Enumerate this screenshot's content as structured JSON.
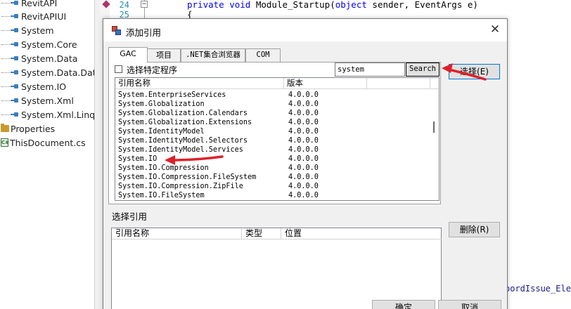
{
  "solution_tree": {
    "items": [
      {
        "label": "RevitAPI",
        "icon": "reference-icon"
      },
      {
        "label": "RevitAPIUI",
        "icon": "reference-icon"
      },
      {
        "label": "System",
        "icon": "reference-icon"
      },
      {
        "label": "System.Core",
        "icon": "reference-icon"
      },
      {
        "label": "System.Data",
        "icon": "reference-icon"
      },
      {
        "label": "System.Data.DataSetExtensions",
        "icon": "reference-icon"
      },
      {
        "label": "System.IO",
        "icon": "reference-icon"
      },
      {
        "label": "System.Xml",
        "icon": "reference-icon"
      },
      {
        "label": "System.Xml.Linq",
        "icon": "reference-icon"
      },
      {
        "label": "Properties",
        "icon": "folder-icon"
      },
      {
        "label": "ThisDocument.cs",
        "icon": "csharp-file-icon"
      }
    ]
  },
  "editor": {
    "line_numbers": [
      "24",
      "25"
    ],
    "code_24_keywords": "private void",
    "code_24_method": " Module_Startup(",
    "code_24_kw2": "object",
    "code_24_rest": " sender, EventArgs e)",
    "code_25": "{",
    "fold_glyph": "−",
    "overflow_text": "oordIssue_Ele"
  },
  "dialog": {
    "title": "添加引用",
    "close_glyph": "✕",
    "tabs": [
      "GAC",
      "项目",
      ".NET集合浏览器",
      "COM"
    ],
    "active_tab": "GAC",
    "checkbox_label": "选择特定程序",
    "checkbox_checked": false,
    "search_value": "system",
    "search_button": "Search",
    "gac_columns": {
      "name": "引用名称",
      "version": "版本"
    },
    "gac_rows": [
      {
        "name": "System.EnterpriseServices",
        "version": "4.0.0.0"
      },
      {
        "name": "System.Globalization",
        "version": "4.0.0.0"
      },
      {
        "name": "System.Globalization.Calendars",
        "version": "4.0.0.0"
      },
      {
        "name": "System.Globalization.Extensions",
        "version": "4.0.0.0"
      },
      {
        "name": "System.IdentityModel",
        "version": "4.0.0.0"
      },
      {
        "name": "System.IdentityModel.Selectors",
        "version": "4.0.0.0"
      },
      {
        "name": "System.IdentityModel.Services",
        "version": "4.0.0.0"
      },
      {
        "name": "System.IO",
        "version": "4.0.0.0"
      },
      {
        "name": "System.IO.Compression",
        "version": "4.0.0.0"
      },
      {
        "name": "System.IO.Compression.FileSystem",
        "version": "4.0.0.0"
      },
      {
        "name": "System.IO.Compression.ZipFile",
        "version": "4.0.0.0"
      },
      {
        "name": "System.IO.FileSystem",
        "version": "4.0.0.0"
      }
    ],
    "select_button": "选择(E)",
    "selected_label": "选择引用",
    "selected_columns": {
      "name": "引用名称",
      "type": "类型",
      "location": "位置"
    },
    "remove_button": "删除(R)",
    "ok_button": "确定",
    "cancel_button": "取消"
  },
  "colors": {
    "annotation_arrow": "#e0202a",
    "keyword": "#0000ff",
    "line_number": "#2b91af"
  }
}
